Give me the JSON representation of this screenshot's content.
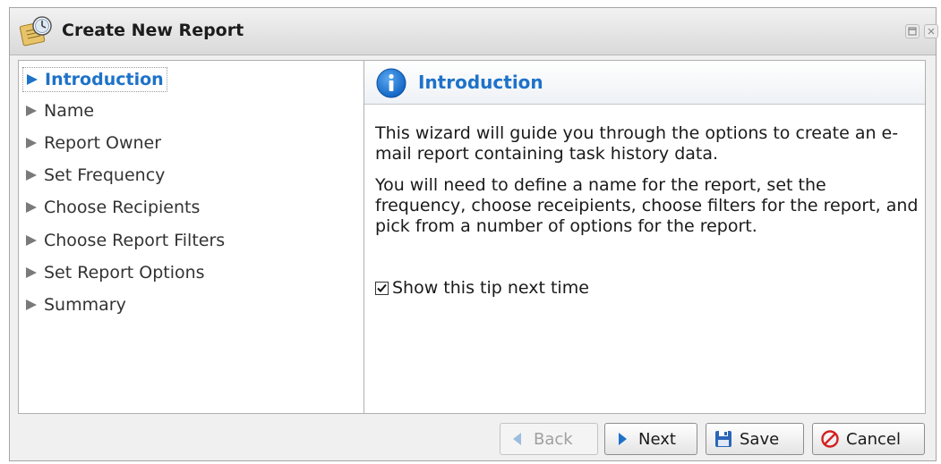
{
  "window": {
    "title": "Create New Report",
    "app_icon": "report-clock-icon",
    "controls": [
      "restore-icon",
      "close-icon"
    ]
  },
  "nav": {
    "items": [
      {
        "label": "Introduction",
        "active": true
      },
      {
        "label": "Name",
        "active": false
      },
      {
        "label": "Report Owner",
        "active": false
      },
      {
        "label": "Set Frequency",
        "active": false
      },
      {
        "label": "Choose Recipients",
        "active": false
      },
      {
        "label": "Choose Report Filters",
        "active": false
      },
      {
        "label": "Set Report Options",
        "active": false
      },
      {
        "label": "Summary",
        "active": false
      }
    ]
  },
  "detail": {
    "title": "Introduction",
    "icon": "info-icon",
    "paragraph1": "This wizard will guide you through the options to create an e-mail report containing task history data.",
    "paragraph2": "You will need to define a name for the report, set the frequency, choose receipients, choose filters for the report, and pick from a number of options for the report.",
    "tip_label": "Show this tip next time",
    "tip_checked": true
  },
  "footer": {
    "back_label": "Back",
    "next_label": "Next",
    "save_label": "Save",
    "cancel_label": "Cancel",
    "back_enabled": false
  },
  "colors": {
    "accent": "#1e72c8",
    "title_bar": "#d9d9d9"
  }
}
